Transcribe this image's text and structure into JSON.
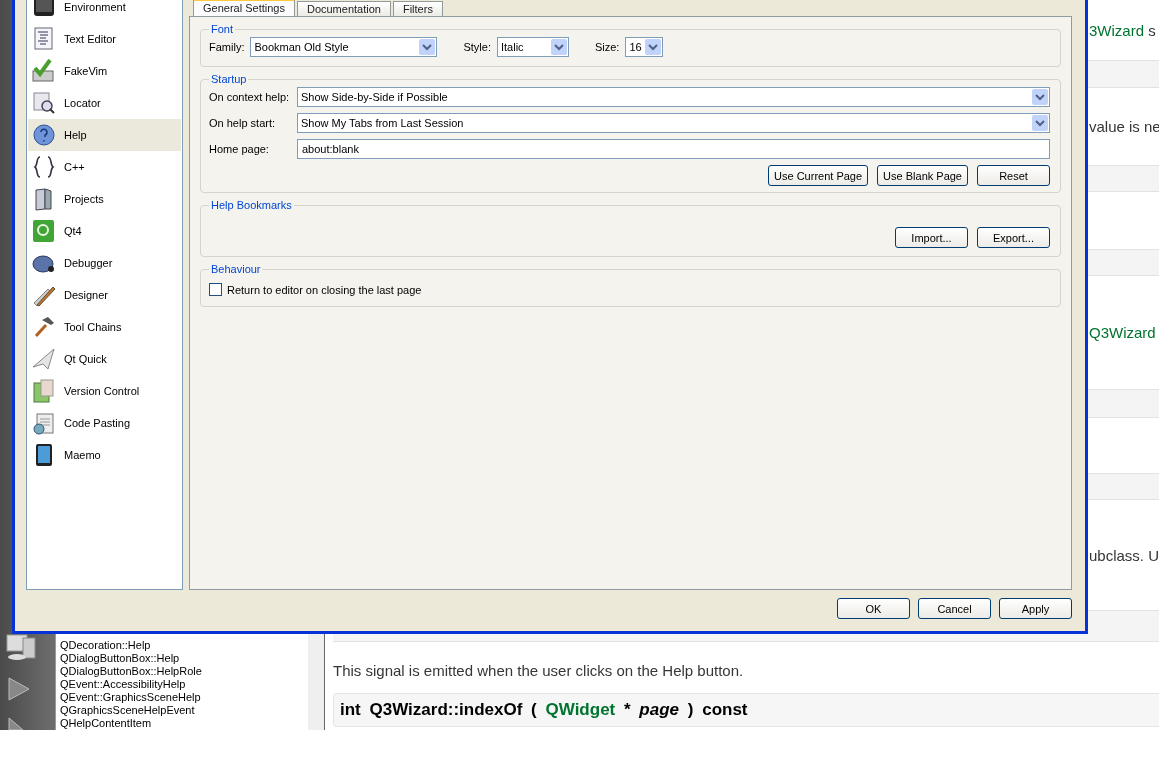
{
  "dialog": {
    "categories": [
      {
        "label": "Environment",
        "selected": false
      },
      {
        "label": "Text Editor",
        "selected": false
      },
      {
        "label": "FakeVim",
        "selected": false
      },
      {
        "label": "Locator",
        "selected": false
      },
      {
        "label": "Help",
        "selected": true
      },
      {
        "label": "C++",
        "selected": false
      },
      {
        "label": "Projects",
        "selected": false
      },
      {
        "label": "Qt4",
        "selected": false
      },
      {
        "label": "Debugger",
        "selected": false
      },
      {
        "label": "Designer",
        "selected": false
      },
      {
        "label": "Tool Chains",
        "selected": false
      },
      {
        "label": "Qt Quick",
        "selected": false
      },
      {
        "label": "Version Control",
        "selected": false
      },
      {
        "label": "Code Pasting",
        "selected": false
      },
      {
        "label": "Maemo",
        "selected": false
      }
    ],
    "tabs": [
      {
        "label": "General Settings",
        "selected": true
      },
      {
        "label": "Documentation",
        "selected": false
      },
      {
        "label": "Filters",
        "selected": false
      }
    ],
    "font": {
      "title": "Font",
      "family_label": "Family:",
      "family": "Bookman Old Style",
      "style_label": "Style:",
      "style": "Italic",
      "size_label": "Size:",
      "size": "16"
    },
    "startup": {
      "title": "Startup",
      "context_label": "On context help:",
      "context": "Show Side-by-Side if Possible",
      "start_label": "On help start:",
      "start": "Show My Tabs from Last Session",
      "home_label": "Home page:",
      "home": "about:blank",
      "buttons": [
        "Use Current Page",
        "Use Blank Page",
        "Reset"
      ]
    },
    "bookmarks": {
      "title": "Help Bookmarks",
      "buttons": [
        "Import...",
        "Export..."
      ]
    },
    "behaviour": {
      "title": "Behaviour",
      "return_label": "Return to editor on closing the last page",
      "checked": false
    },
    "buttons": [
      "OK",
      "Cancel",
      "Apply"
    ]
  },
  "help_index": [
    "QDecoration::Help",
    "QDialogButtonBox::Help",
    "QDialogButtonBox::HelpRole",
    "QEvent::AccessibilityHelp",
    "QEvent::GraphicsSceneHelp",
    "QGraphicsSceneHelpEvent",
    "QHelpContentItem"
  ],
  "document": {
    "fragments": [
      [
        {
          "text": "3Wizard",
          "kind": "link"
        },
        {
          "text": " s",
          "kind": "plain"
        }
      ],
      [
        {
          "text": "value is ne",
          "kind": "plain"
        }
      ],
      [
        {
          "text": "Q3Wizard",
          "kind": "link"
        }
      ],
      [
        {
          "text": "ubclass. U",
          "kind": "plain"
        }
      ]
    ],
    "signal_text": "This signal is emitted when the user clicks on the Help button.",
    "signature": [
      {
        "text": "int",
        "kind": "plain"
      },
      {
        "text": "Q3Wizard::indexOf",
        "kind": "plain"
      },
      {
        "text": "(",
        "kind": "plain"
      },
      {
        "text": "QWidget",
        "kind": "link"
      },
      {
        "text": "*",
        "kind": "plain"
      },
      {
        "text": "page",
        "kind": "param"
      },
      {
        "text": ")",
        "kind": "plain"
      },
      {
        "text": "const",
        "kind": "plain"
      }
    ]
  }
}
